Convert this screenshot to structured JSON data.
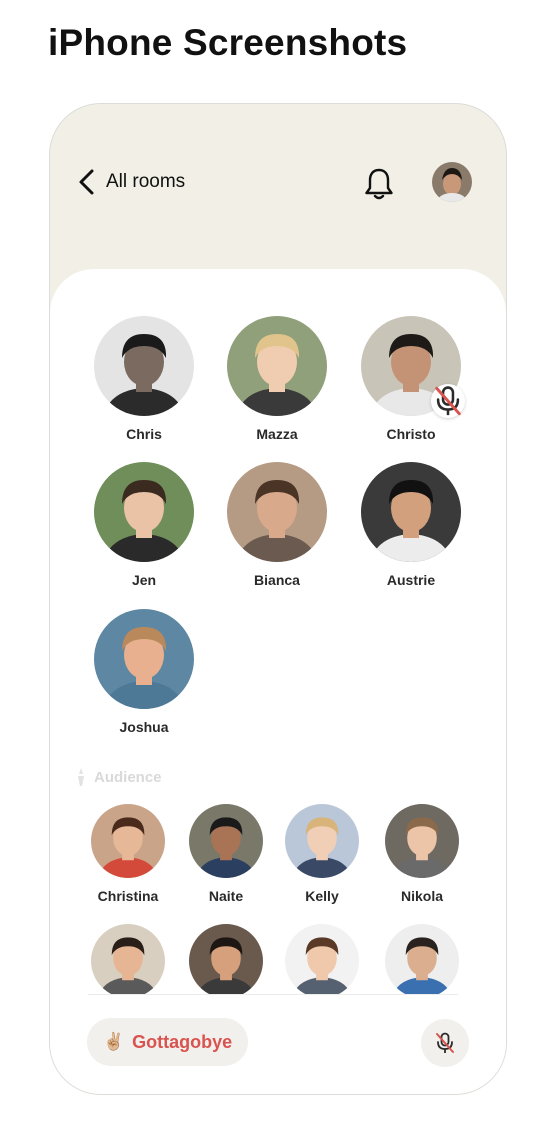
{
  "page_title": "iPhone Screenshots",
  "header": {
    "back_label": "All rooms"
  },
  "speakers": [
    {
      "name": "Chris",
      "muted": false,
      "bg": "#e4e4e4",
      "skin": "#7b6a60",
      "hair": "#1a1a1a",
      "shirt": "#2b2b2b"
    },
    {
      "name": "Mazza",
      "muted": false,
      "bg": "#8fa07a",
      "skin": "#f0cdb0",
      "hair": "#e0c48c",
      "shirt": "#3a3a3a"
    },
    {
      "name": "Christo",
      "muted": true,
      "bg": "#c9c4b8",
      "skin": "#c49274",
      "hair": "#1e1a17",
      "shirt": "#e8e8e8"
    },
    {
      "name": "Jen",
      "muted": false,
      "bg": "#6f8e5a",
      "skin": "#eac3a6",
      "hair": "#3b2a20",
      "shirt": "#2a2a2a"
    },
    {
      "name": "Bianca",
      "muted": false,
      "bg": "#b59a84",
      "skin": "#d9a98b",
      "hair": "#4a3426",
      "shirt": "#6a5a50"
    },
    {
      "name": "Austrie",
      "muted": false,
      "bg": "#3a3a3a",
      "skin": "#d3a07e",
      "hair": "#111111",
      "shirt": "#ececec"
    },
    {
      "name": "Joshua",
      "muted": false,
      "bg": "#5d87a3",
      "skin": "#e9b08f",
      "hair": "#b9895c",
      "shirt": "#4d7896"
    }
  ],
  "audience_label": "Audience",
  "audience": [
    {
      "name": "Christina",
      "bg": "#c9a489",
      "skin": "#e6b898",
      "hair": "#4a2a1a",
      "shirt": "#d44a3a"
    },
    {
      "name": "Naite",
      "bg": "#7a7868",
      "skin": "#a87455",
      "hair": "#1a1a1a",
      "shirt": "#2b4060"
    },
    {
      "name": "Kelly",
      "bg": "#b9c7d9",
      "skin": "#f0cfb6",
      "hair": "#d8b47a",
      "shirt": "#3a4a66"
    },
    {
      "name": "Nikola",
      "bg": "#6e6a62",
      "skin": "#ecc4a8",
      "hair": "#8a6a4a",
      "shirt": "#6a6a6a"
    },
    {
      "name": "",
      "bg": "#d9cfc0",
      "skin": "#e6b594",
      "hair": "#2a1e18",
      "shirt": "#5a5a5a"
    },
    {
      "name": "",
      "bg": "#6a5a4e",
      "skin": "#d7a07c",
      "hair": "#1e1612",
      "shirt": "#3a3a3a"
    },
    {
      "name": "",
      "bg": "#f2f2f2",
      "skin": "#f0c8ac",
      "hair": "#5a3a26",
      "shirt": "#556070"
    },
    {
      "name": "",
      "bg": "#eeeeee",
      "skin": "#dcae90",
      "hair": "#2a221e",
      "shirt": "#3a6fb0"
    }
  ],
  "leave_button": {
    "emoji": "✌🏼",
    "label": "Gottagobye"
  },
  "colors": {
    "accent": "#d9534f",
    "header_bg": "#f2f0e6",
    "sheet_bg": "#ffffff"
  }
}
